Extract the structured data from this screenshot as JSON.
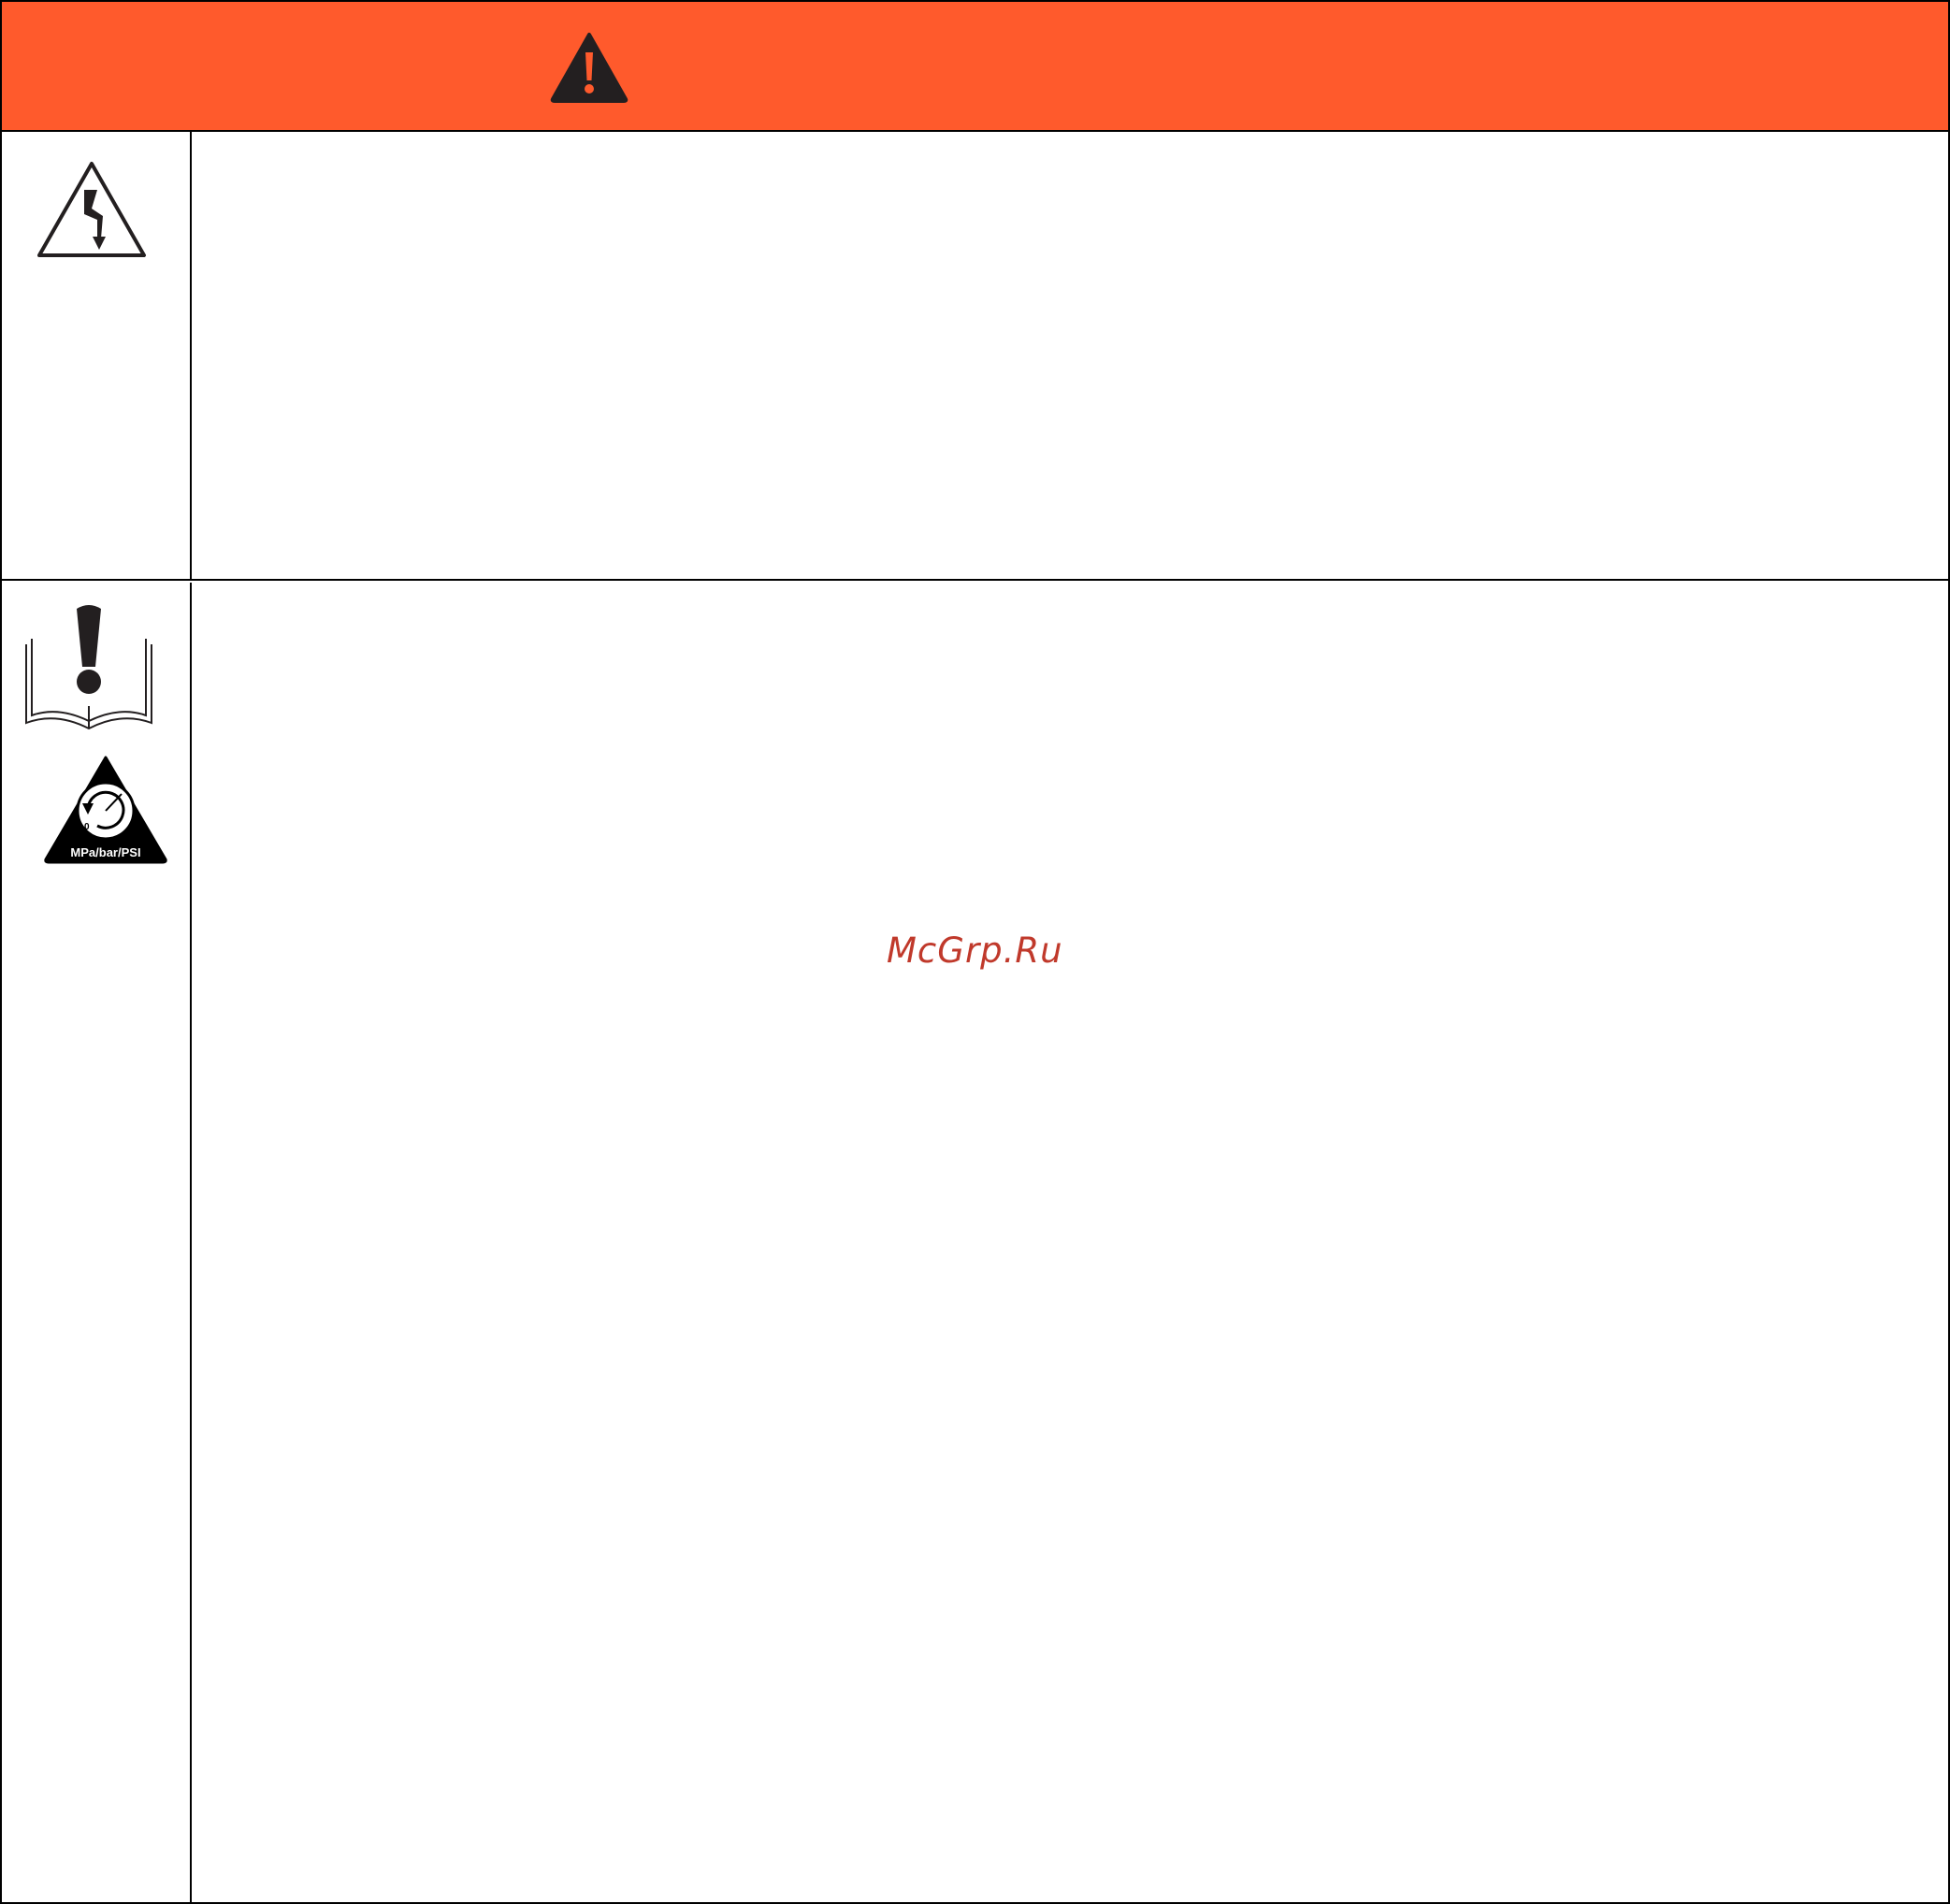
{
  "header": {
    "icon": "warning-triangle-icon",
    "color": "#ff5a2c"
  },
  "rows": [
    {
      "icons": [
        "electric-shock-icon"
      ]
    },
    {
      "icons": [
        "read-manual-icon",
        "pressure-relief-icon"
      ],
      "pressure_icon_text": "MPa/bar/PSI"
    }
  ],
  "watermark": "McGrp.Ru"
}
